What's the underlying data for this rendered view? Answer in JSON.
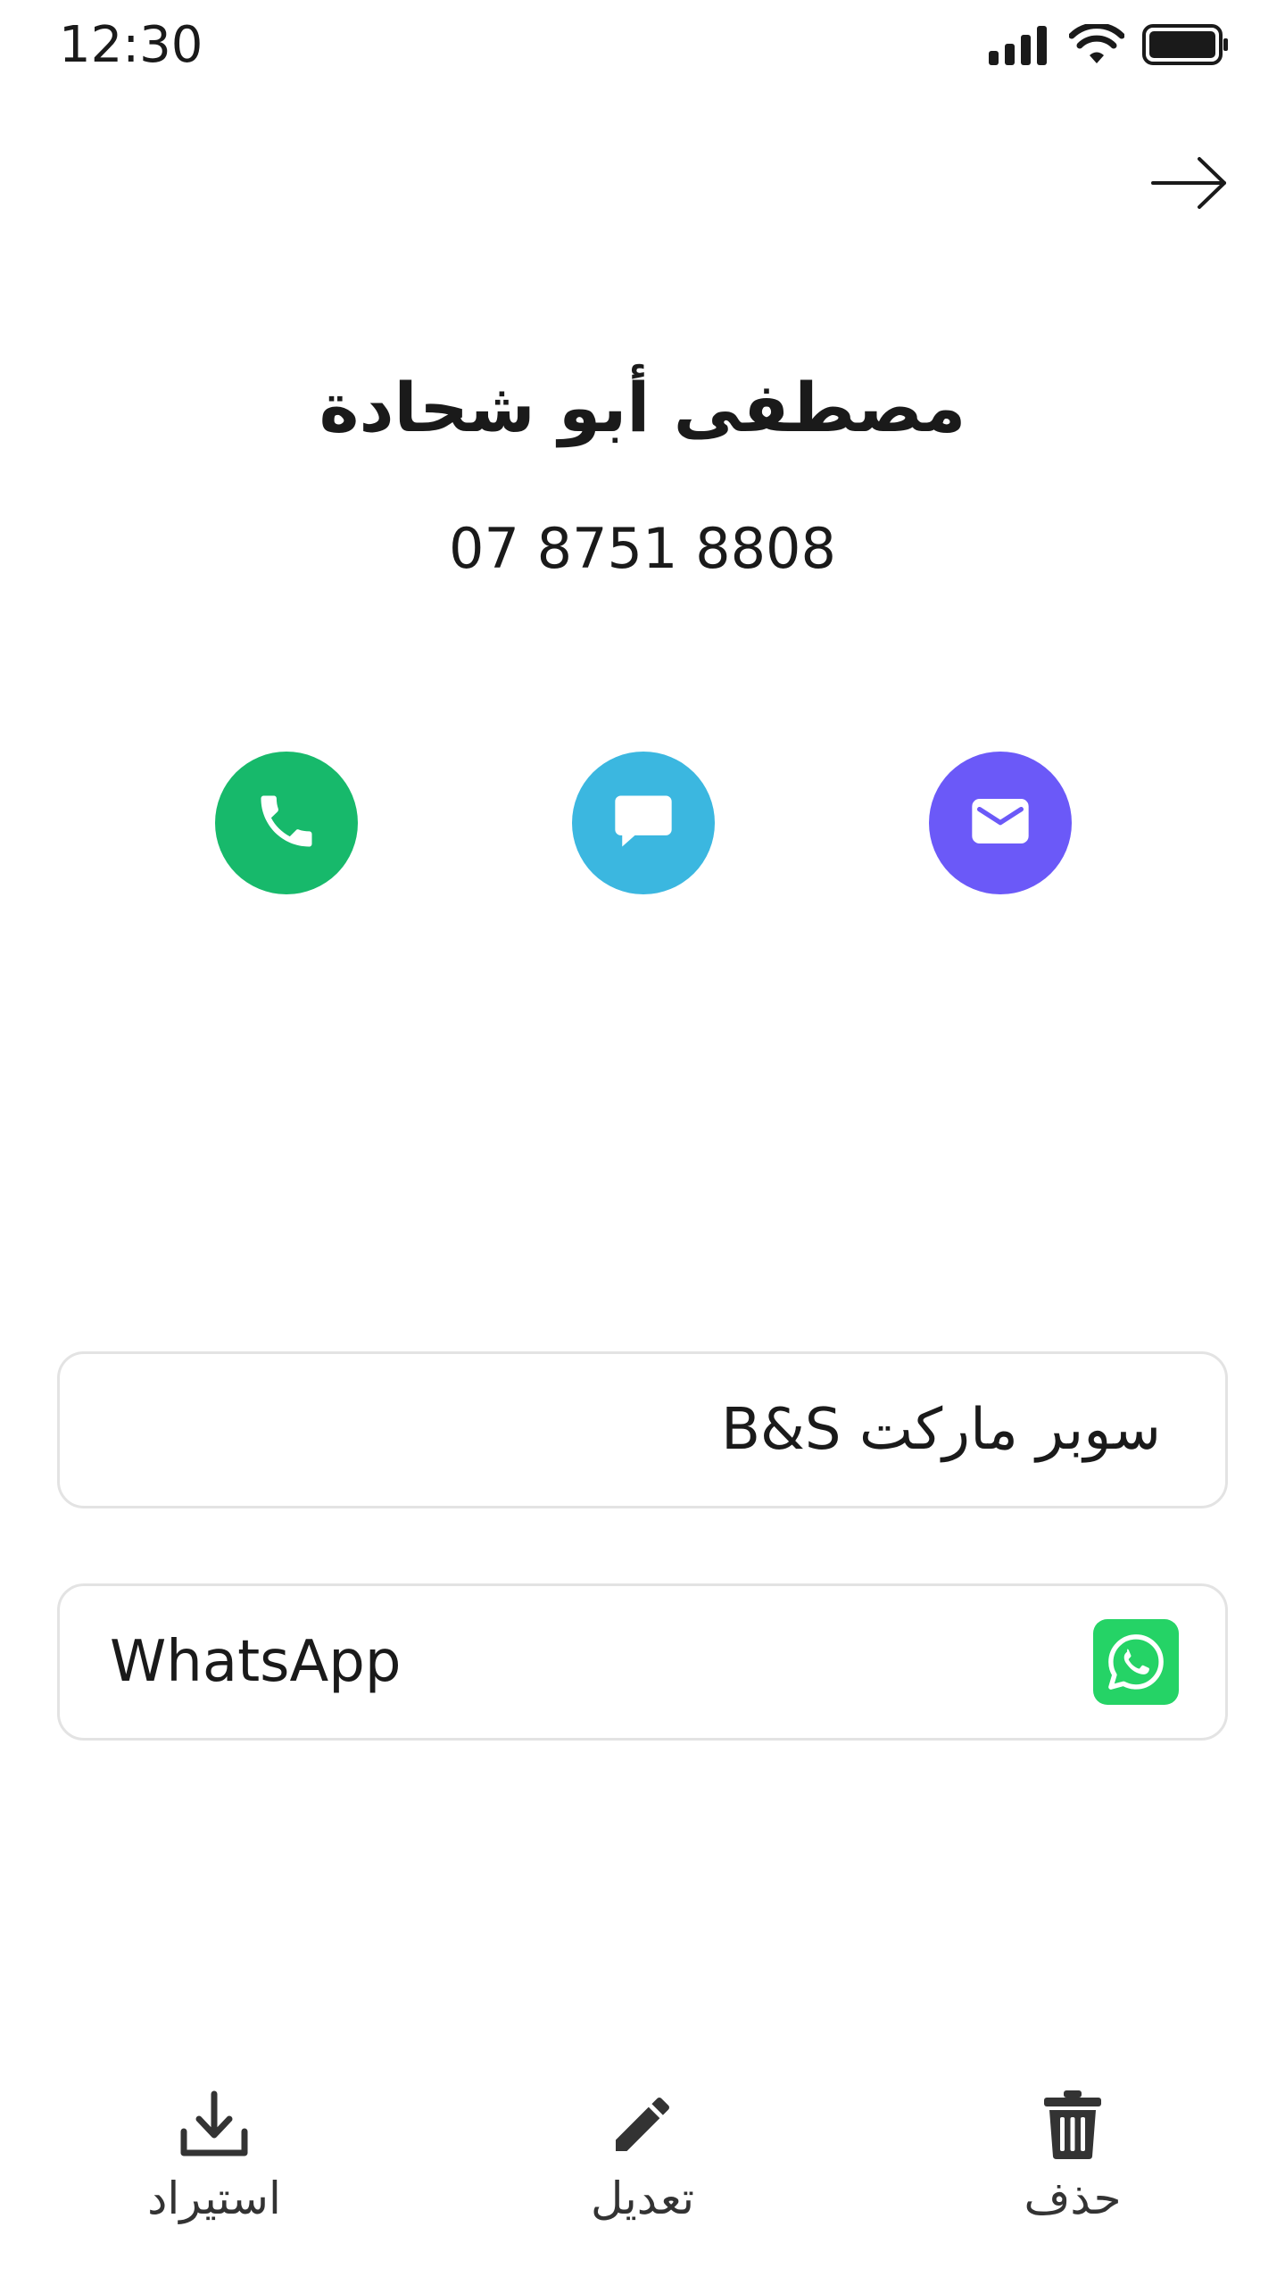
{
  "status_bar": {
    "time": "12:30"
  },
  "contact": {
    "name": "مصطفى أبو شحادة",
    "phone": "07 8751 8808"
  },
  "actions": {
    "call_icon": "phone-icon",
    "message_icon": "message-icon",
    "email_icon": "envelope-icon",
    "call_color": "#17b96b",
    "message_color": "#3bb7e0",
    "email_color": "#6b59f8"
  },
  "details": {
    "company": "سوبر ماركت B&S",
    "whatsapp_label": "WhatsApp",
    "whatsapp_color": "#25d366"
  },
  "toolbar": {
    "import_label": "استيراد",
    "edit_label": "تعديل",
    "delete_label": "حذف"
  }
}
